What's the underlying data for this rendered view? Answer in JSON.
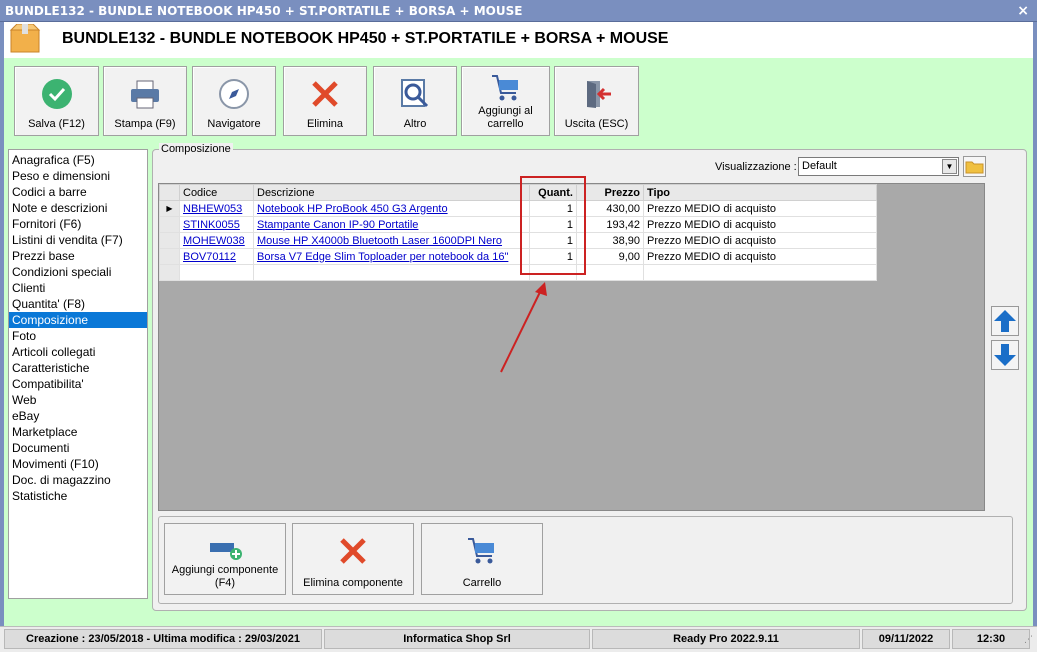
{
  "window": {
    "title": "BUNDLE132 - BUNDLE NOTEBOOK HP450 + ST.PORTATILE + BORSA + MOUSE",
    "close": "×"
  },
  "header": {
    "title": "BUNDLE132 - BUNDLE NOTEBOOK HP450 + ST.PORTATILE + BORSA + MOUSE"
  },
  "toolbar": {
    "save": "Salva (F12)",
    "print": "Stampa (F9)",
    "navigator": "Navigatore",
    "delete": "Elimina",
    "other": "Altro",
    "cart_line1": "Aggiungi al",
    "cart_line2": "carrello",
    "exit": "Uscita (ESC)"
  },
  "nav": {
    "items": [
      "Anagrafica (F5)",
      "Peso e dimensioni",
      "Codici a barre",
      "Note e descrizioni",
      "Fornitori (F6)",
      "Listini di vendita (F7)",
      "Prezzi base",
      "Condizioni speciali",
      "Clienti",
      "Quantita' (F8)",
      "Composizione",
      "Foto",
      "Articoli collegati",
      "Caratteristiche",
      "Compatibilita'",
      "Web",
      "eBay",
      "Marketplace",
      "Documenti",
      "Movimenti (F10)",
      "Doc. di magazzino",
      "Statistiche"
    ],
    "selected": "Composizione"
  },
  "panel": {
    "legend": "Composizione",
    "vis_label": "Visualizzazione :",
    "vis_value": "Default"
  },
  "grid": {
    "columns": {
      "code": "Codice",
      "desc": "Descrizione",
      "qty": "Quant.",
      "price": "Prezzo",
      "type": "Tipo"
    },
    "rows": [
      {
        "code": "NBHEW053",
        "desc": "Notebook HP ProBook 450 G3 Argento",
        "qty": "1",
        "price": "430,00",
        "type": "Prezzo MEDIO di acquisto"
      },
      {
        "code": "STINK0055",
        "desc": "Stampante Canon IP-90 Portatile",
        "qty": "1",
        "price": "193,42",
        "type": "Prezzo MEDIO di acquisto"
      },
      {
        "code": "MOHEW038",
        "desc": "Mouse HP X4000b Bluetooth Laser 1600DPI Nero",
        "qty": "1",
        "price": "38,90",
        "type": "Prezzo MEDIO di acquisto"
      },
      {
        "code": "BOV70112",
        "desc": "Borsa V7 Edge Slim Toploader per notebook da 16\"",
        "qty": "1",
        "price": "9,00",
        "type": "Prezzo MEDIO di acquisto"
      }
    ]
  },
  "bottom": {
    "add_line1": "Aggiungi componente",
    "add_line2": "(F4)",
    "remove": "Elimina componente",
    "cart": "Carrello"
  },
  "status": {
    "dates": "Creazione : 23/05/2018 - Ultima modifica : 29/03/2021",
    "company": "Informatica Shop Srl",
    "version": "Ready Pro 2022.9.11",
    "date": "09/11/2022",
    "time": "12:30"
  },
  "colors": {
    "accent_red": "#cc2222",
    "selection": "#0a78d7",
    "green_bg": "#ccffcc"
  }
}
